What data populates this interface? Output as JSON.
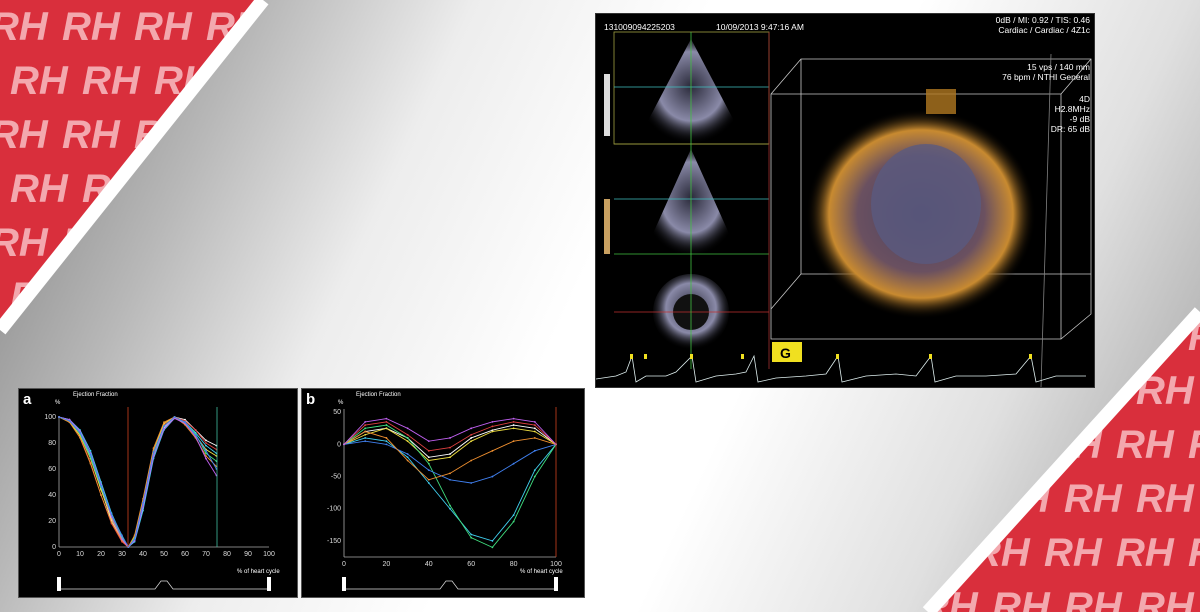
{
  "brand": {
    "logo_text": "RH",
    "colors": {
      "red": "#d92f3c",
      "pink": "#f3a8ae"
    }
  },
  "ultrasound": {
    "study_id": "131009094225203",
    "datetime": "10/09/2013 9:47:16 AM",
    "top_right": [
      "0dB / MI: 0.92 / TIS: 0.46",
      "Cardiac / Cardiac / 4Z1c"
    ],
    "rate_info": [
      "15 vps / 140 mm",
      "76 bpm / NTHI General"
    ],
    "params": [
      "4D",
      "H2.8MHz",
      "-9 dB",
      "DR: 65 dB"
    ]
  },
  "charts": {
    "a": {
      "panel_label": "a",
      "title": "Ejection Fraction",
      "y_unit": "%",
      "x_label": "% of heart cycle"
    },
    "b": {
      "panel_label": "b",
      "title": "Ejection Fraction",
      "y_unit": "%",
      "x_label": "% of heart cycle"
    }
  },
  "chart_data": [
    {
      "type": "line",
      "title": "Ejection Fraction",
      "xlabel": "% of heart cycle",
      "ylabel": "%",
      "xlim": [
        0,
        100
      ],
      "ylim": [
        0,
        100
      ],
      "xticks": [
        0,
        10,
        20,
        30,
        40,
        50,
        60,
        70,
        80,
        90,
        100
      ],
      "yticks": [
        0,
        20,
        40,
        60,
        80,
        100
      ],
      "x": [
        0,
        5,
        10,
        15,
        20,
        25,
        30,
        33,
        36,
        40,
        45,
        50,
        55,
        60,
        65,
        70,
        75
      ],
      "series": [
        {
          "values": [
            100,
            98,
            88,
            70,
            45,
            20,
            5,
            0,
            5,
            30,
            70,
            92,
            100,
            98,
            90,
            82,
            78
          ],
          "color": "#ffffff"
        },
        {
          "values": [
            100,
            97,
            85,
            65,
            40,
            18,
            4,
            0,
            6,
            32,
            72,
            94,
            100,
            97,
            90,
            80,
            75
          ],
          "color": "#e04040"
        },
        {
          "values": [
            100,
            96,
            86,
            68,
            44,
            22,
            6,
            0,
            8,
            35,
            74,
            95,
            100,
            95,
            86,
            75,
            70
          ],
          "color": "#f0e040"
        },
        {
          "values": [
            100,
            98,
            90,
            74,
            50,
            26,
            8,
            0,
            4,
            28,
            68,
            90,
            99,
            96,
            88,
            78,
            72
          ],
          "color": "#40d0f0"
        },
        {
          "values": [
            100,
            97,
            87,
            69,
            46,
            24,
            7,
            0,
            7,
            33,
            71,
            93,
            100,
            96,
            87,
            72,
            66
          ],
          "color": "#40e080"
        },
        {
          "values": [
            100,
            96,
            84,
            64,
            40,
            19,
            5,
            0,
            9,
            37,
            76,
            96,
            100,
            94,
            84,
            70,
            62
          ],
          "color": "#f09030"
        },
        {
          "values": [
            100,
            98,
            89,
            72,
            48,
            23,
            6,
            0,
            5,
            31,
            70,
            91,
            99,
            95,
            85,
            68,
            55
          ],
          "color": "#c060f0"
        },
        {
          "values": [
            100,
            97,
            88,
            71,
            47,
            25,
            9,
            0,
            6,
            34,
            73,
            93,
            100,
            96,
            86,
            74,
            60
          ],
          "color": "#4080f0"
        }
      ]
    },
    {
      "type": "line",
      "title": "Ejection Fraction",
      "xlabel": "% of heart cycle",
      "ylabel": "%",
      "xlim": [
        0,
        100
      ],
      "ylim": [
        -175,
        55
      ],
      "xticks": [
        0,
        20,
        40,
        60,
        80,
        100
      ],
      "yticks": [
        50,
        0,
        -50,
        -100,
        -150
      ],
      "x": [
        0,
        10,
        20,
        30,
        40,
        50,
        60,
        70,
        80,
        90,
        100
      ],
      "series": [
        {
          "values": [
            0,
            20,
            25,
            10,
            -20,
            -15,
            10,
            22,
            30,
            25,
            0
          ],
          "color": "#ffffff"
        },
        {
          "values": [
            0,
            30,
            35,
            15,
            -10,
            -5,
            15,
            28,
            35,
            30,
            0
          ],
          "color": "#e04040"
        },
        {
          "values": [
            0,
            15,
            25,
            5,
            -25,
            -20,
            5,
            20,
            25,
            20,
            0
          ],
          "color": "#f0e040"
        },
        {
          "values": [
            0,
            10,
            5,
            -20,
            -60,
            -100,
            -140,
            -150,
            -110,
            -40,
            0
          ],
          "color": "#40d0f0"
        },
        {
          "values": [
            0,
            25,
            30,
            10,
            -30,
            -95,
            -145,
            -160,
            -120,
            -50,
            0
          ],
          "color": "#40e080"
        },
        {
          "values": [
            0,
            5,
            0,
            -15,
            -40,
            -55,
            -60,
            -50,
            -30,
            -10,
            0
          ],
          "color": "#4080f0"
        },
        {
          "values": [
            0,
            20,
            10,
            -25,
            -55,
            -45,
            -25,
            -10,
            5,
            10,
            0
          ],
          "color": "#f09030"
        },
        {
          "values": [
            0,
            35,
            40,
            25,
            5,
            10,
            25,
            35,
            40,
            35,
            0
          ],
          "color": "#c060f0"
        }
      ]
    }
  ]
}
